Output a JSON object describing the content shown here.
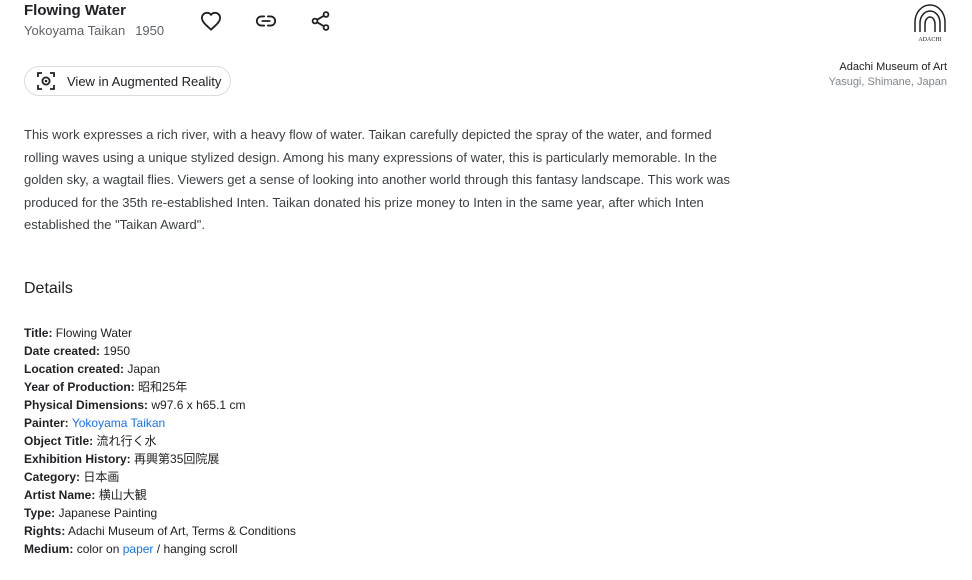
{
  "artwork": {
    "title": "Flowing Water",
    "artist": "Yokoyama Taikan",
    "year": "1950"
  },
  "actions": {
    "favorite_icon": "heart-icon",
    "link_icon": "link-icon",
    "share_icon": "share-icon"
  },
  "ar_button": {
    "label": "View in Augmented Reality",
    "icon": "augmented-reality-icon"
  },
  "museum": {
    "logo_text": "ADACHI",
    "name": "Adachi Museum of Art",
    "location": "Yasugi, Shimane, Japan"
  },
  "description": "This work expresses a rich river, with a heavy flow of water. Taikan carefully depicted the spray of the water, and formed rolling waves using a unique stylized design. Among his many expressions of water, this is particularly memorable. In the golden sky, a wagtail flies. Viewers get a sense of looking into another world through this fantasy landscape. This work was produced for the 35th re-established Inten. Taikan donated his prize money to Inten in the same year, after which Inten established the \"Taikan Award\".",
  "details": {
    "heading": "Details",
    "title": {
      "label": "Title:",
      "value": "Flowing Water"
    },
    "date_created": {
      "label": "Date created:",
      "value": "1950"
    },
    "location_created": {
      "label": "Location created:",
      "value": "Japan"
    },
    "year_of_production": {
      "label": "Year of Production:",
      "value": "昭和25年"
    },
    "physical_dimensions": {
      "label": "Physical Dimensions:",
      "value": "w97.6 x h65.1 cm"
    },
    "painter": {
      "label": "Painter:",
      "value": "Yokoyama Taikan"
    },
    "object_title": {
      "label": "Object Title:",
      "value": "流れ行く水"
    },
    "exhibition_history": {
      "label": "Exhibition History:",
      "value": "再興第35回院展"
    },
    "category": {
      "label": "Category:",
      "value": "日本画"
    },
    "artist_name": {
      "label": "Artist Name:",
      "value": "横山大観"
    },
    "type": {
      "label": "Type:",
      "value": "Japanese Painting"
    },
    "rights": {
      "label": "Rights:",
      "value": "Adachi Museum of Art, Terms & Conditions"
    },
    "medium": {
      "label": "Medium:",
      "prefix": "color on",
      "link": "paper",
      "suffix": "/ hanging scroll"
    }
  },
  "colors": {
    "link": "#1a73e8",
    "text": "#202124",
    "muted": "#5f6368"
  }
}
